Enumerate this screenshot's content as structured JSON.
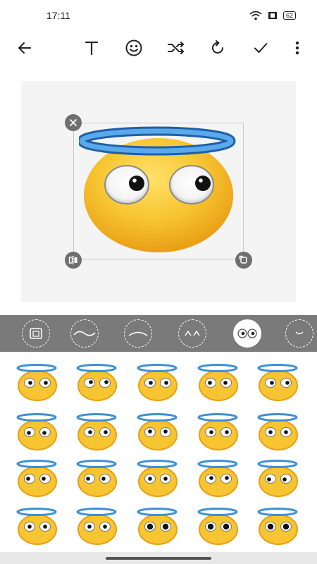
{
  "status": {
    "time": "17:11",
    "battery": "62"
  },
  "toolbar": {
    "icons": [
      "back-arrow-icon",
      "text-icon",
      "emoji-icon",
      "shuffle-icon",
      "redo-icon",
      "checkmark-icon",
      "more-vertical-icon"
    ]
  },
  "colors": {
    "halo": "#3d8fd8",
    "face": "#f7c531",
    "face_shadow": "#e99f16",
    "strip": "#7a7a7a",
    "canvas": "#f4f4f4"
  },
  "style_options": [
    {
      "name": "image",
      "selected": false
    },
    {
      "name": "wave",
      "selected": false
    },
    {
      "name": "brows",
      "selected": false
    },
    {
      "name": "eyes-closed",
      "selected": false
    },
    {
      "name": "eyes",
      "selected": true
    },
    {
      "name": "mouth",
      "selected": false
    }
  ],
  "grid": {
    "rows": 4,
    "cols": 5
  }
}
